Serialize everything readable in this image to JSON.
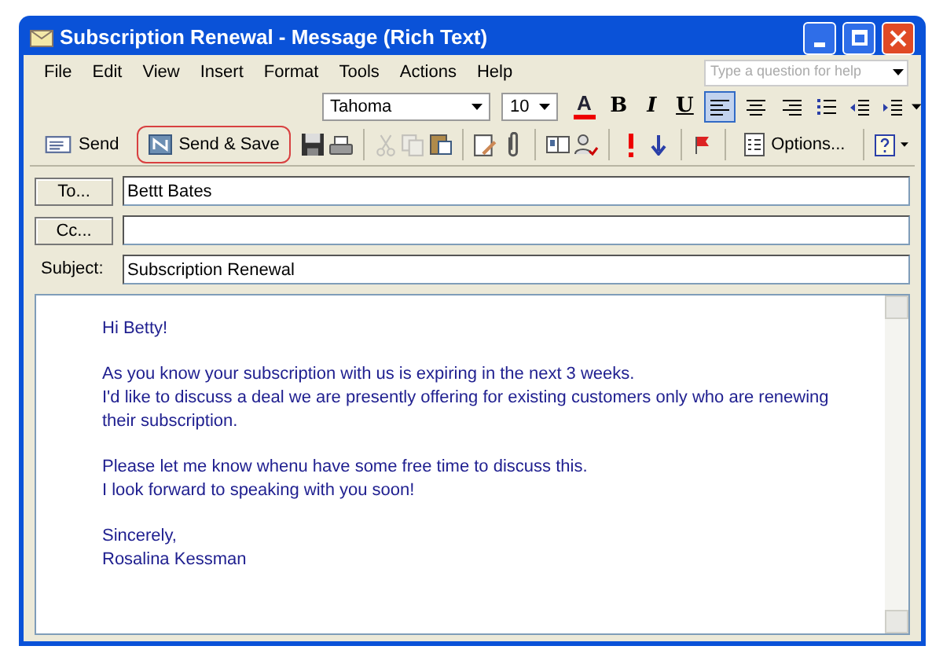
{
  "window": {
    "title": "Subscription Renewal - Message (Rich Text)"
  },
  "menu": [
    "File",
    "Edit",
    "View",
    "Insert",
    "Format",
    "Tools",
    "Actions",
    "Help"
  ],
  "help_search": {
    "placeholder": "Type a question for help"
  },
  "formatting_toolbar": {
    "font": "Tahoma",
    "size": "10",
    "items": [
      {
        "kind": "fontcolor",
        "label": "A"
      },
      {
        "kind": "text",
        "label": "B",
        "selected": false
      },
      {
        "kind": "text",
        "label": "I",
        "selected": false
      },
      {
        "kind": "text",
        "label": "U",
        "selected": false
      },
      {
        "kind": "align",
        "selected": true
      },
      {
        "kind": "align",
        "selected": false
      },
      {
        "kind": "align",
        "selected": false
      },
      {
        "kind": "icon"
      },
      {
        "kind": "icon"
      },
      {
        "kind": "icon"
      }
    ]
  },
  "standard_toolbar": [
    {
      "kind": "button",
      "label": "Send",
      "highlighted": false
    },
    {
      "kind": "button",
      "label": "Send & Save",
      "highlighted": true
    },
    {
      "kind": "icon",
      "disabled": false
    },
    {
      "kind": "icon",
      "disabled": false
    },
    {
      "kind": "sep"
    },
    {
      "kind": "icon",
      "disabled": true
    },
    {
      "kind": "icon",
      "disabled": true
    },
    {
      "kind": "icon",
      "disabled": false
    },
    {
      "kind": "sep"
    },
    {
      "kind": "icon",
      "disabled": false
    },
    {
      "kind": "icon",
      "disabled": false
    },
    {
      "kind": "sep"
    },
    {
      "kind": "icon",
      "disabled": false
    },
    {
      "kind": "icon",
      "disabled": false
    },
    {
      "kind": "sep"
    },
    {
      "kind": "icon",
      "disabled": false
    },
    {
      "kind": "icon",
      "disabled": false
    },
    {
      "kind": "sep"
    },
    {
      "kind": "icon",
      "disabled": false
    },
    {
      "kind": "sep"
    },
    {
      "kind": "button",
      "label": "Options...",
      "highlighted": false
    },
    {
      "kind": "sep"
    },
    {
      "kind": "icon",
      "disabled": false
    }
  ],
  "fields": [
    {
      "kind": "button",
      "label": "To...",
      "value": "Bettt Bates"
    },
    {
      "kind": "button",
      "label": "Cc..."
    },
    {
      "kind": "label",
      "label": "Subject:",
      "value": "Subscription Renewal"
    }
  ],
  "body": {
    "paragraphs": [
      [
        "Hi Betty!"
      ],
      [
        "As you know your subscription with us is expiring in the next 3 weeks.",
        "I'd like to discuss a deal we are presently offering for existing customers only who are renewing their subscription."
      ],
      [
        "Please let me know whenu have some free time to discuss this.",
        "I look forward to speaking with you soon!"
      ],
      [
        "Sincerely,",
        "Rosalina Kessman"
      ]
    ]
  }
}
